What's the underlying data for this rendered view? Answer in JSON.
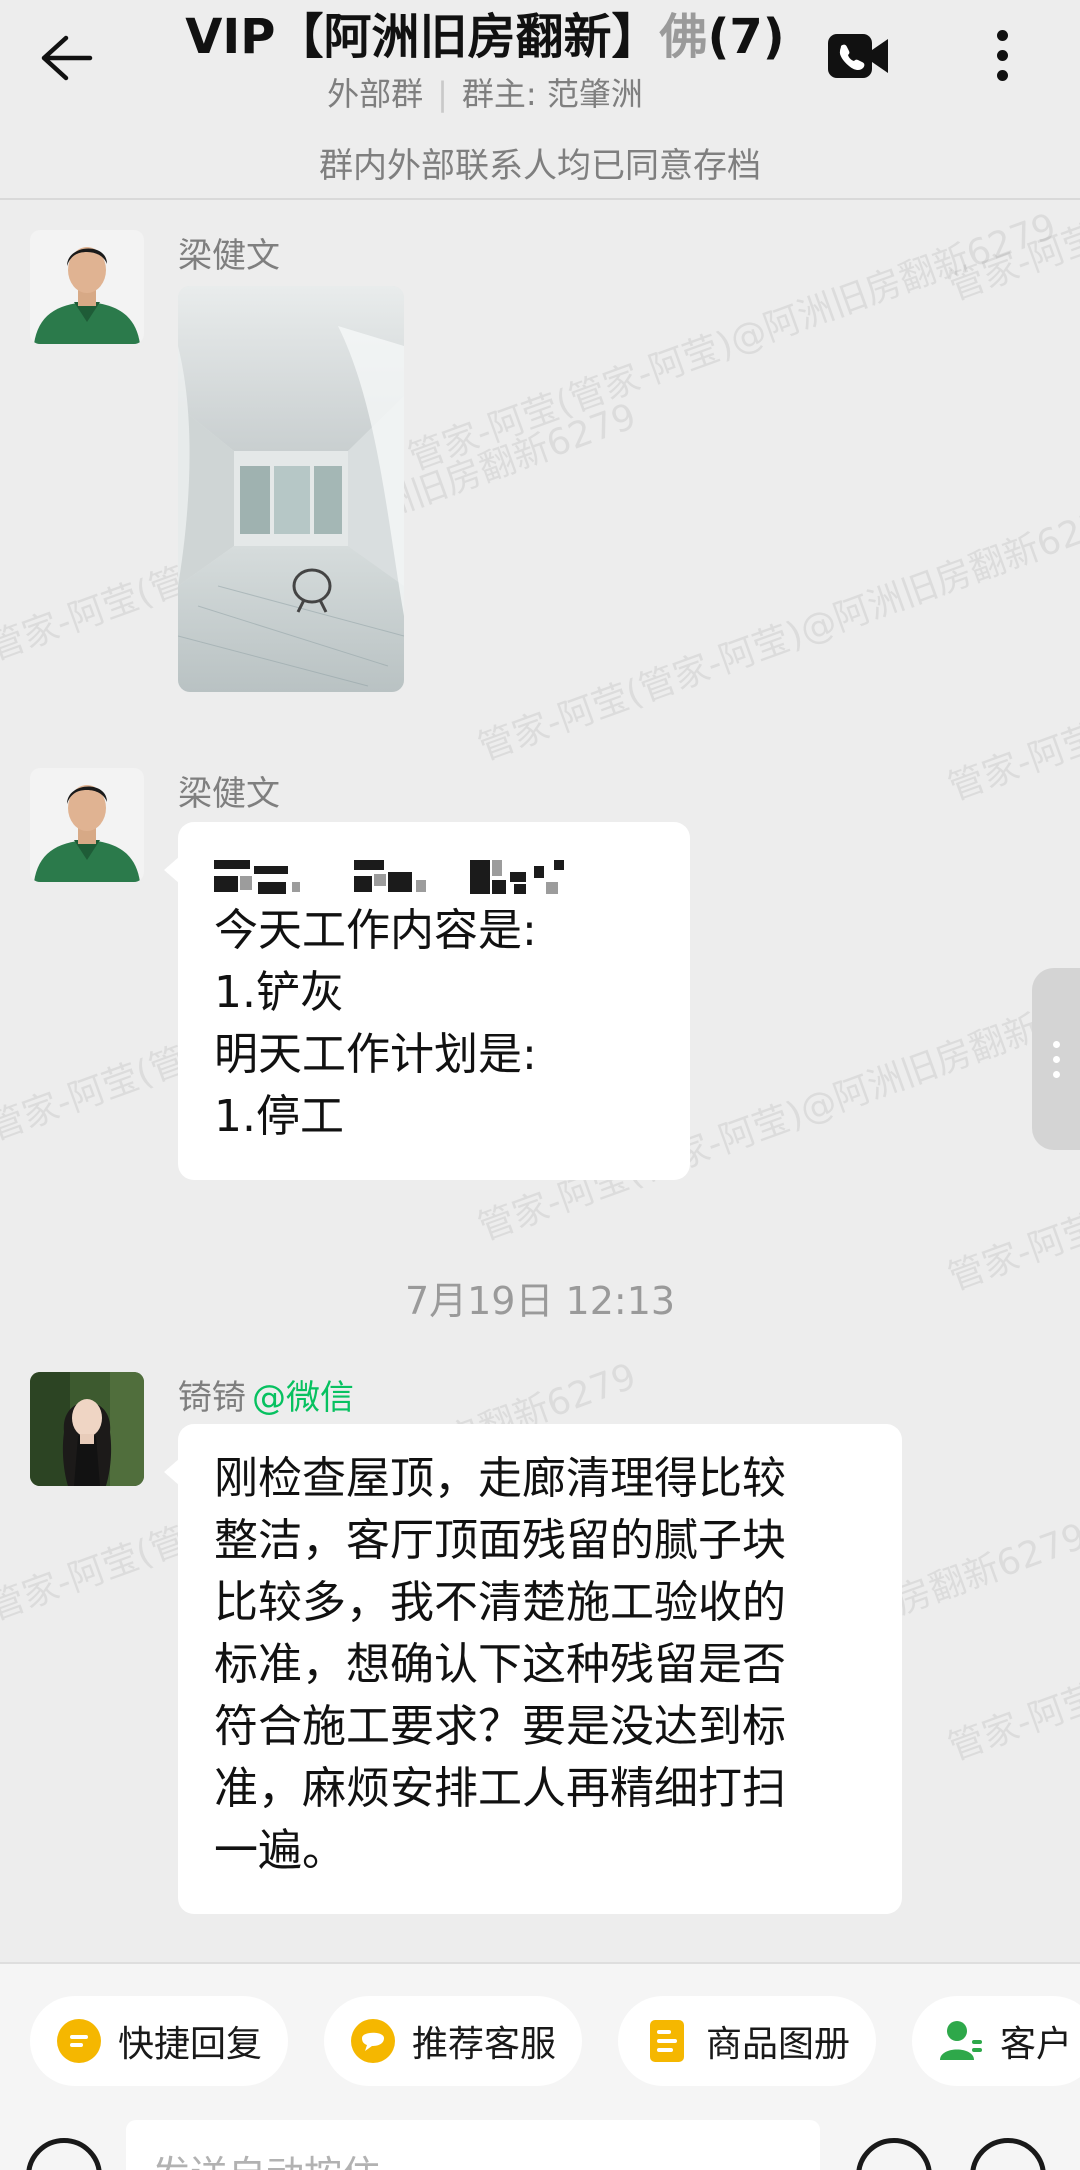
{
  "header": {
    "title": "VIP【阿洲旧房翻新】佛",
    "title_fade": "佛",
    "member_count": "(7)",
    "group_type": "外部群",
    "owner": "群主: 范肇洲",
    "archive_notice": "群内外部联系人均已同意存档"
  },
  "watermark": "管家-阿莹(管家-阿莹)@阿洲旧房翻新6279",
  "messages": [
    {
      "sender": "梁健文",
      "type": "image"
    },
    {
      "sender": "梁健文",
      "type": "text",
      "lines": [
        "今天工作内容是:",
        "1.铲灰",
        "明天工作计划是:",
        "1.停工"
      ]
    }
  ],
  "time_divider": "7月19日  12:13",
  "message3": {
    "sender": "锜锜",
    "sender_tag": "@微信",
    "lines": [
      "刚检查屋顶，走廊清理得比较",
      "整洁，客厅顶面残留的腻子块",
      "比较多，我不清楚施工验收的",
      "标准，想确认下这种残留是否",
      "符合施工要求？要是没达到标",
      "准，麻烦安排工人再精细打扫",
      "一遍。"
    ]
  },
  "quick_actions": {
    "quick_reply": "快捷回复",
    "recommend_service": "推荐客服",
    "product_album": "商品图册",
    "customer": "客户"
  },
  "input": {
    "placeholder": "发送自动按住"
  },
  "colors": {
    "accent_green": "#07c160",
    "chip_yellow": "#f5b700",
    "chip_green": "#2ea84a"
  }
}
